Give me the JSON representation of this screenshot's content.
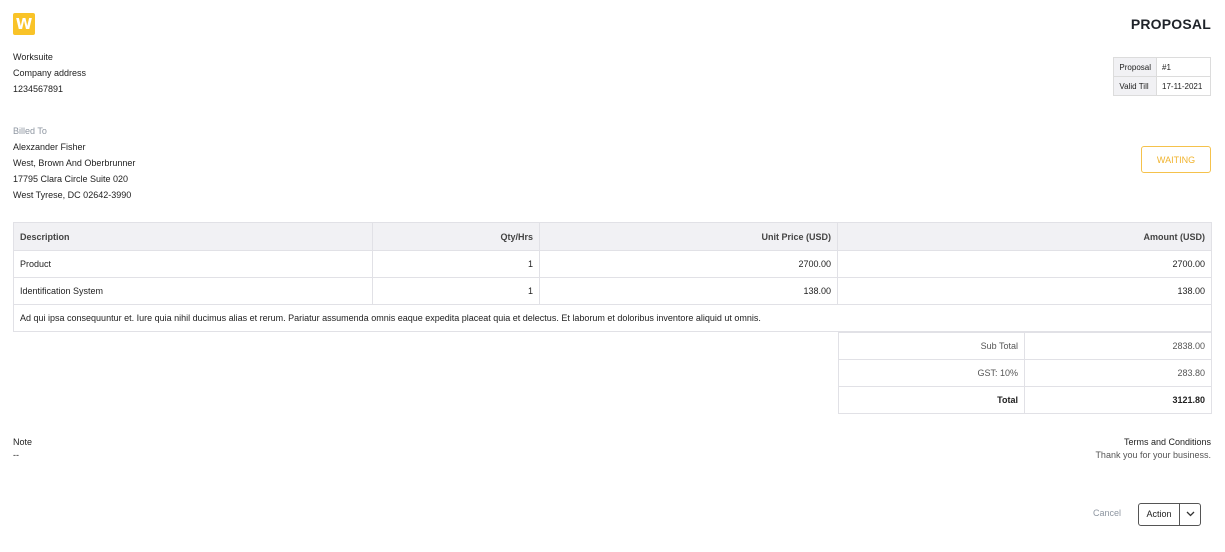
{
  "brand": {
    "logo_letter": "W",
    "accent": "#f9c328"
  },
  "document": {
    "title": "PROPOSAL"
  },
  "company": {
    "name": "Worksuite",
    "address": "Company address",
    "phone": "1234567891"
  },
  "meta": {
    "proposal_label": "Proposal",
    "proposal_value": "#1",
    "valid_label": "Valid Till",
    "valid_value": "17-11-2021"
  },
  "billed_to": {
    "label": "Billed To",
    "name": "Alexzander Fisher",
    "company": "West, Brown And Oberbrunner",
    "street": "17795 Clara Circle Suite 020",
    "city": "West Tyrese, DC 02642-3990"
  },
  "status": {
    "label": "WAITING",
    "color": "#f0b32d"
  },
  "items": {
    "headers": {
      "description": "Description",
      "qty": "Qty/Hrs",
      "unit_price": "Unit Price (USD)",
      "amount": "Amount (USD)"
    },
    "rows": [
      {
        "description": "Product",
        "qty": "1",
        "unit_price": "2700.00",
        "amount": "2700.00"
      },
      {
        "description": "Identification System",
        "qty": "1",
        "unit_price": "138.00",
        "amount": "138.00"
      }
    ],
    "description_text": "Ad qui ipsa consequuntur et. Iure quia nihil ducimus alias et rerum. Pariatur assumenda omnis eaque expedita placeat quia et delectus. Et laborum et doloribus inventore aliquid ut omnis."
  },
  "totals": {
    "subtotal_label": "Sub Total",
    "subtotal_value": "2838.00",
    "tax_label": "GST: 10%",
    "tax_value": "283.80",
    "total_label": "Total",
    "total_value": "3121.80"
  },
  "note": {
    "label": "Note",
    "value": "--"
  },
  "terms": {
    "label": "Terms and Conditions",
    "value": "Thank you for your business."
  },
  "actions": {
    "cancel_label": "Cancel",
    "action_label": "Action",
    "chevron_icon": "chevron-down-icon"
  }
}
